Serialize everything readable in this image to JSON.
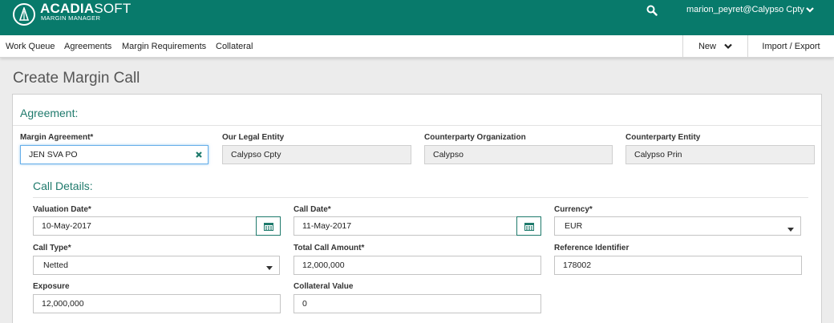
{
  "header": {
    "brand_bold": "ACADIA",
    "brand_light": "SOFT",
    "brand_sub": "MARGIN MANAGER",
    "user": "marion_peyret@Calypso Cpty",
    "accent_color": "#087a6b"
  },
  "nav": {
    "items": [
      "Work Queue",
      "Agreements",
      "Margin Requirements",
      "Collateral"
    ],
    "new_label": "New",
    "import_export_label": "Import / Export"
  },
  "page": {
    "title": "Create Margin Call"
  },
  "agreement": {
    "section_title": "Agreement:",
    "margin_agreement": {
      "label": "Margin Agreement*",
      "value": "JEN SVA PO"
    },
    "our_legal_entity": {
      "label": "Our Legal Entity",
      "value": "Calypso Cpty"
    },
    "counterparty_org": {
      "label": "Counterparty Organization",
      "value": "Calypso"
    },
    "counterparty_entity": {
      "label": "Counterparty Entity",
      "value": "Calypso Prin"
    }
  },
  "call_details": {
    "section_title": "Call Details:",
    "valuation_date": {
      "label": "Valuation Date*",
      "value": "10-May-2017"
    },
    "call_date": {
      "label": "Call Date*",
      "value": "11-May-2017"
    },
    "currency": {
      "label": "Currency*",
      "value": "EUR"
    },
    "call_type": {
      "label": "Call Type*",
      "value": "Netted"
    },
    "total_call_amount": {
      "label": "Total Call Amount*",
      "value": "12,000,000"
    },
    "reference_identifier": {
      "label": "Reference Identifier",
      "value": "178002"
    },
    "exposure": {
      "label": "Exposure",
      "value": "12,000,000"
    },
    "collateral_value": {
      "label": "Collateral Value",
      "value": "0"
    }
  }
}
